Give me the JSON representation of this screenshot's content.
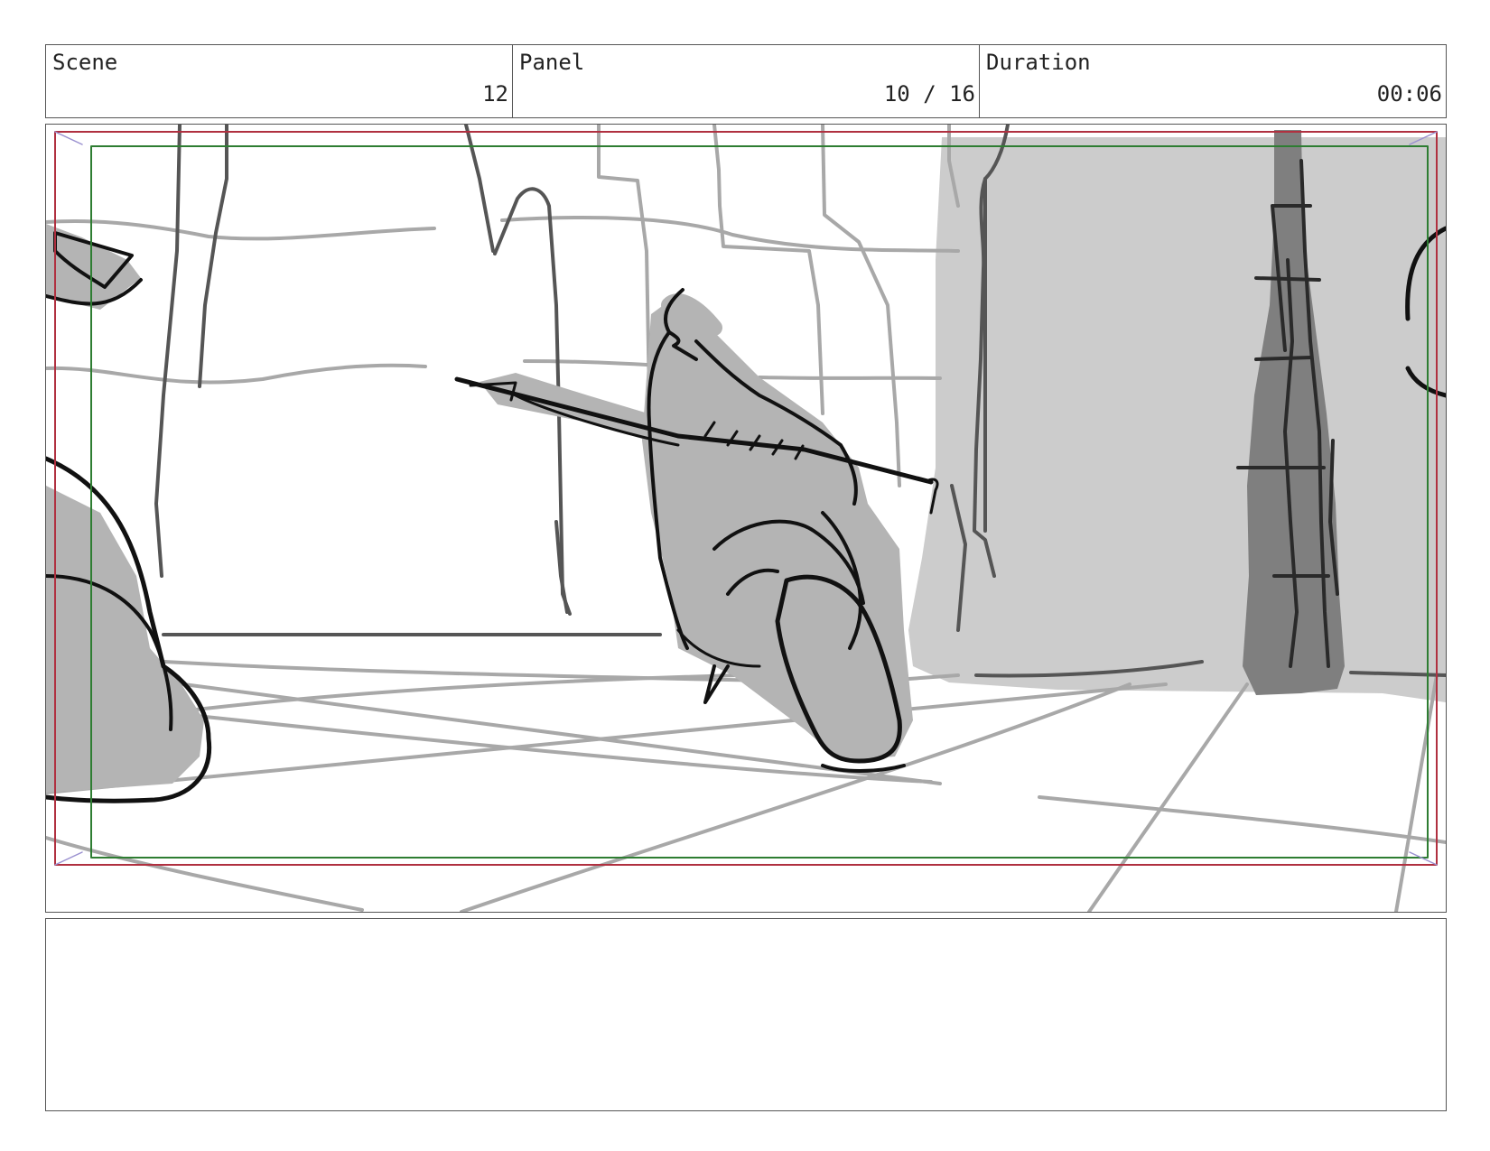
{
  "header": {
    "scene_label": "Scene",
    "scene_value": "12",
    "panel_label": "Panel",
    "panel_value": "10 / 16",
    "duration_label": "Duration",
    "duration_value": "00:06"
  },
  "notes": {
    "text": ""
  },
  "colors": {
    "safe_frame_red": "#b03040",
    "title_safe_green": "#2e7d32",
    "shadow_fill": "#b4b4b4",
    "wall_fill": "#cccccc",
    "trunk_fill": "#7f7f7f",
    "ink": "#111111"
  }
}
